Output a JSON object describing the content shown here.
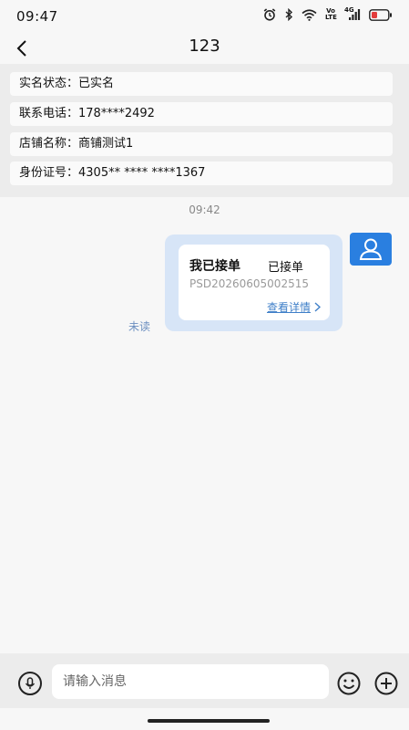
{
  "status_bar": {
    "time": "09:47",
    "icons": [
      "alarm-icon",
      "bluetooth-icon",
      "wifi-icon",
      "volte-icon",
      "cellular-4g-icon",
      "battery-icon"
    ],
    "volte_label": "Vo LTE",
    "network_label": "4G"
  },
  "nav": {
    "title": "123",
    "back_icon": "chevron-left-icon"
  },
  "info": {
    "rows": [
      {
        "label": "实名状态：",
        "value": "已实名"
      },
      {
        "label": "联系电话：",
        "value": "178****2492"
      },
      {
        "label": "店铺名称：",
        "value": "商铺测试1"
      },
      {
        "label": "身份证号：",
        "value": "4305** **** ****1367"
      }
    ]
  },
  "chat": {
    "timestamp": "09:42",
    "message": {
      "title": "我已接单",
      "status": "已接单",
      "order_number": "PSD20260605002515",
      "link_label": "查看详情",
      "read_status": "未读"
    },
    "avatar_icon": "user-avatar-icon"
  },
  "input_bar": {
    "placeholder": "请输入消息",
    "voice_icon": "voice-icon",
    "emoji_icon": "emoji-icon",
    "plus_icon": "plus-icon"
  },
  "colors": {
    "accent": "#2a7fe0",
    "bubble": "#d7e5f7",
    "link": "#3f7fc8",
    "panel": "#ececec"
  }
}
